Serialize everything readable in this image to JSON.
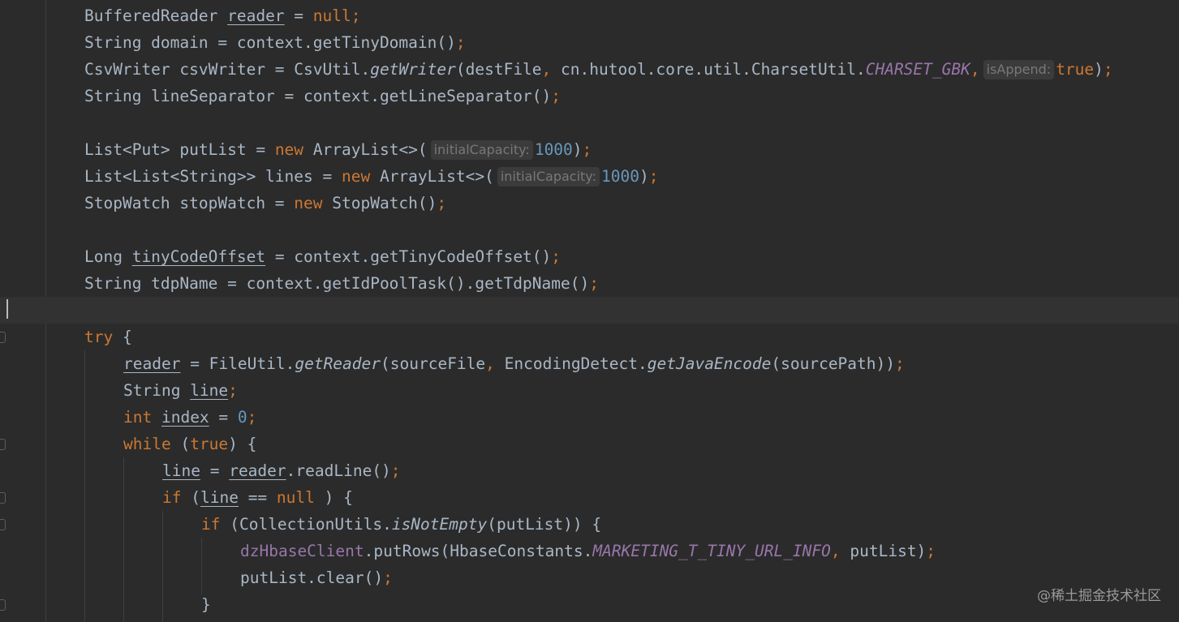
{
  "editor": {
    "lines": [
      {
        "indent": 0,
        "tokens": [
          {
            "t": "BufferedReader ",
            "c": "plain"
          },
          {
            "t": "reader",
            "c": "plain-u"
          },
          {
            "t": " = ",
            "c": "plain"
          },
          {
            "t": "null",
            "c": "kw"
          },
          {
            "t": ";",
            "c": "punct"
          }
        ]
      },
      {
        "indent": 0,
        "tokens": [
          {
            "t": "String domain = context.getTinyDomain()",
            "c": "plain"
          },
          {
            "t": ";",
            "c": "punct"
          }
        ]
      },
      {
        "indent": 0,
        "tokens": [
          {
            "t": "CsvWriter csvWriter = CsvUtil.",
            "c": "plain"
          },
          {
            "t": "getWriter",
            "c": "method-static"
          },
          {
            "t": "(destFile",
            "c": "plain"
          },
          {
            "t": ", ",
            "c": "punct"
          },
          {
            "t": "cn.hutool.core.util.CharsetUtil.",
            "c": "plain"
          },
          {
            "t": "CHARSET_GBK",
            "c": "static"
          },
          {
            "t": ",",
            "c": "punct"
          },
          {
            "t": "isAppend:",
            "c": "hint"
          },
          {
            "t": "true",
            "c": "kw"
          },
          {
            "t": ")",
            "c": "plain"
          },
          {
            "t": ";",
            "c": "punct"
          }
        ]
      },
      {
        "indent": 0,
        "tokens": [
          {
            "t": "String lineSeparator = context.getLineSeparator()",
            "c": "plain"
          },
          {
            "t": ";",
            "c": "punct"
          }
        ]
      },
      {
        "indent": 0,
        "tokens": []
      },
      {
        "indent": 0,
        "tokens": [
          {
            "t": "List<Put> putList = ",
            "c": "plain"
          },
          {
            "t": "new ",
            "c": "kw"
          },
          {
            "t": "ArrayList<>(",
            "c": "plain"
          },
          {
            "t": "initialCapacity:",
            "c": "hint"
          },
          {
            "t": "1000",
            "c": "num"
          },
          {
            "t": ")",
            "c": "plain"
          },
          {
            "t": ";",
            "c": "punct"
          }
        ]
      },
      {
        "indent": 0,
        "tokens": [
          {
            "t": "List<List<String>> lines = ",
            "c": "plain"
          },
          {
            "t": "new ",
            "c": "kw"
          },
          {
            "t": "ArrayList<>(",
            "c": "plain"
          },
          {
            "t": "initialCapacity:",
            "c": "hint"
          },
          {
            "t": "1000",
            "c": "num"
          },
          {
            "t": ")",
            "c": "plain"
          },
          {
            "t": ";",
            "c": "punct"
          }
        ]
      },
      {
        "indent": 0,
        "tokens": [
          {
            "t": "StopWatch stopWatch = ",
            "c": "plain"
          },
          {
            "t": "new ",
            "c": "kw"
          },
          {
            "t": "StopWatch()",
            "c": "plain"
          },
          {
            "t": ";",
            "c": "punct"
          }
        ]
      },
      {
        "indent": 0,
        "tokens": []
      },
      {
        "indent": 0,
        "tokens": [
          {
            "t": "Long ",
            "c": "plain"
          },
          {
            "t": "tinyCodeOffset",
            "c": "plain-u"
          },
          {
            "t": " = context.getTinyCodeOffset()",
            "c": "plain"
          },
          {
            "t": ";",
            "c": "punct"
          }
        ]
      },
      {
        "indent": 0,
        "tokens": [
          {
            "t": "String tdpName = context.getIdPoolTask().getTdpName()",
            "c": "plain"
          },
          {
            "t": ";",
            "c": "punct"
          }
        ]
      },
      {
        "indent": 0,
        "tokens": [],
        "current": true
      },
      {
        "indent": 0,
        "tokens": [
          {
            "t": "try ",
            "c": "kw"
          },
          {
            "t": "{",
            "c": "plain"
          }
        ]
      },
      {
        "indent": 1,
        "tokens": [
          {
            "t": "reader",
            "c": "plain-u"
          },
          {
            "t": " = FileUtil.",
            "c": "plain"
          },
          {
            "t": "getReader",
            "c": "method-static"
          },
          {
            "t": "(sourceFile",
            "c": "plain"
          },
          {
            "t": ", ",
            "c": "punct"
          },
          {
            "t": "EncodingDetect.",
            "c": "plain"
          },
          {
            "t": "getJavaEncode",
            "c": "method-static"
          },
          {
            "t": "(sourcePath))",
            "c": "plain"
          },
          {
            "t": ";",
            "c": "punct"
          }
        ]
      },
      {
        "indent": 1,
        "tokens": [
          {
            "t": "String ",
            "c": "plain"
          },
          {
            "t": "line",
            "c": "plain-u"
          },
          {
            "t": ";",
            "c": "punct"
          }
        ]
      },
      {
        "indent": 1,
        "tokens": [
          {
            "t": "int ",
            "c": "kw"
          },
          {
            "t": "index",
            "c": "plain-u"
          },
          {
            "t": " = ",
            "c": "plain"
          },
          {
            "t": "0",
            "c": "num"
          },
          {
            "t": ";",
            "c": "punct"
          }
        ]
      },
      {
        "indent": 1,
        "tokens": [
          {
            "t": "while ",
            "c": "kw"
          },
          {
            "t": "(",
            "c": "plain"
          },
          {
            "t": "true",
            "c": "kw"
          },
          {
            "t": ") {",
            "c": "plain"
          }
        ]
      },
      {
        "indent": 2,
        "tokens": [
          {
            "t": "line",
            "c": "plain-u"
          },
          {
            "t": " = ",
            "c": "plain"
          },
          {
            "t": "reader",
            "c": "plain-u"
          },
          {
            "t": ".readLine()",
            "c": "plain"
          },
          {
            "t": ";",
            "c": "punct"
          }
        ]
      },
      {
        "indent": 2,
        "tokens": [
          {
            "t": "if ",
            "c": "kw"
          },
          {
            "t": "(",
            "c": "plain"
          },
          {
            "t": "line",
            "c": "plain-u"
          },
          {
            "t": " == ",
            "c": "plain"
          },
          {
            "t": "null ",
            "c": "kw"
          },
          {
            "t": ") {",
            "c": "plain"
          }
        ]
      },
      {
        "indent": 3,
        "tokens": [
          {
            "t": "if ",
            "c": "kw"
          },
          {
            "t": "(CollectionUtils.",
            "c": "plain"
          },
          {
            "t": "isNotEmpty",
            "c": "method-static"
          },
          {
            "t": "(putList)) {",
            "c": "plain"
          }
        ]
      },
      {
        "indent": 4,
        "tokens": [
          {
            "t": "dzHbaseClient",
            "c": "field"
          },
          {
            "t": ".putRows(HbaseConstants.",
            "c": "plain"
          },
          {
            "t": "MARKETING_T_TINY_URL_INFO",
            "c": "static"
          },
          {
            "t": ", ",
            "c": "punct"
          },
          {
            "t": "putList)",
            "c": "plain"
          },
          {
            "t": ";",
            "c": "punct"
          }
        ]
      },
      {
        "indent": 4,
        "tokens": [
          {
            "t": "putList.clear()",
            "c": "plain"
          },
          {
            "t": ";",
            "c": "punct"
          }
        ]
      },
      {
        "indent": 3,
        "tokens": [
          {
            "t": "}",
            "c": "plain"
          }
        ]
      }
    ]
  },
  "watermark": "@稀土掘金技术社区"
}
